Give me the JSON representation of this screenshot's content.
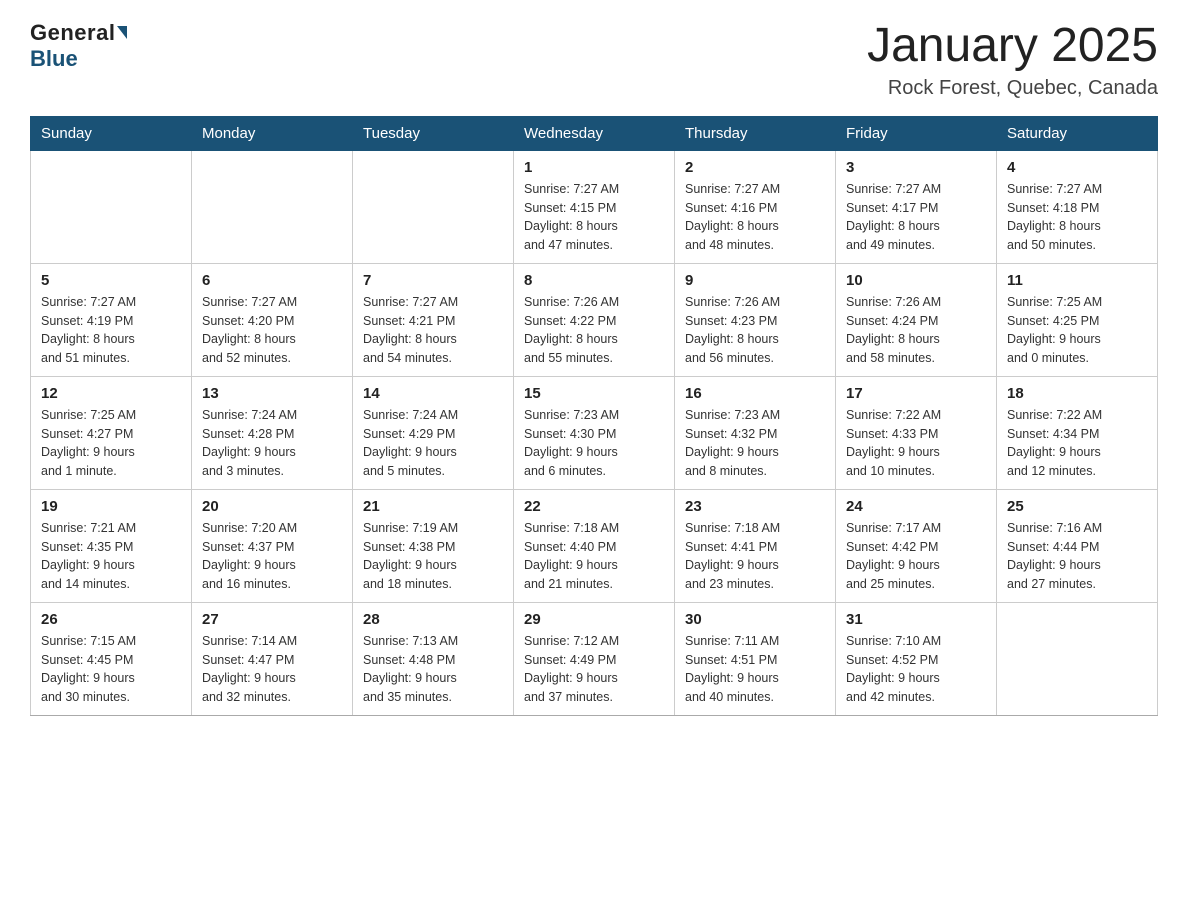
{
  "logo": {
    "general": "General",
    "blue": "Blue"
  },
  "title": "January 2025",
  "subtitle": "Rock Forest, Quebec, Canada",
  "days_of_week": [
    "Sunday",
    "Monday",
    "Tuesday",
    "Wednesday",
    "Thursday",
    "Friday",
    "Saturday"
  ],
  "weeks": [
    [
      {
        "day": "",
        "info": ""
      },
      {
        "day": "",
        "info": ""
      },
      {
        "day": "",
        "info": ""
      },
      {
        "day": "1",
        "info": "Sunrise: 7:27 AM\nSunset: 4:15 PM\nDaylight: 8 hours\nand 47 minutes."
      },
      {
        "day": "2",
        "info": "Sunrise: 7:27 AM\nSunset: 4:16 PM\nDaylight: 8 hours\nand 48 minutes."
      },
      {
        "day": "3",
        "info": "Sunrise: 7:27 AM\nSunset: 4:17 PM\nDaylight: 8 hours\nand 49 minutes."
      },
      {
        "day": "4",
        "info": "Sunrise: 7:27 AM\nSunset: 4:18 PM\nDaylight: 8 hours\nand 50 minutes."
      }
    ],
    [
      {
        "day": "5",
        "info": "Sunrise: 7:27 AM\nSunset: 4:19 PM\nDaylight: 8 hours\nand 51 minutes."
      },
      {
        "day": "6",
        "info": "Sunrise: 7:27 AM\nSunset: 4:20 PM\nDaylight: 8 hours\nand 52 minutes."
      },
      {
        "day": "7",
        "info": "Sunrise: 7:27 AM\nSunset: 4:21 PM\nDaylight: 8 hours\nand 54 minutes."
      },
      {
        "day": "8",
        "info": "Sunrise: 7:26 AM\nSunset: 4:22 PM\nDaylight: 8 hours\nand 55 minutes."
      },
      {
        "day": "9",
        "info": "Sunrise: 7:26 AM\nSunset: 4:23 PM\nDaylight: 8 hours\nand 56 minutes."
      },
      {
        "day": "10",
        "info": "Sunrise: 7:26 AM\nSunset: 4:24 PM\nDaylight: 8 hours\nand 58 minutes."
      },
      {
        "day": "11",
        "info": "Sunrise: 7:25 AM\nSunset: 4:25 PM\nDaylight: 9 hours\nand 0 minutes."
      }
    ],
    [
      {
        "day": "12",
        "info": "Sunrise: 7:25 AM\nSunset: 4:27 PM\nDaylight: 9 hours\nand 1 minute."
      },
      {
        "day": "13",
        "info": "Sunrise: 7:24 AM\nSunset: 4:28 PM\nDaylight: 9 hours\nand 3 minutes."
      },
      {
        "day": "14",
        "info": "Sunrise: 7:24 AM\nSunset: 4:29 PM\nDaylight: 9 hours\nand 5 minutes."
      },
      {
        "day": "15",
        "info": "Sunrise: 7:23 AM\nSunset: 4:30 PM\nDaylight: 9 hours\nand 6 minutes."
      },
      {
        "day": "16",
        "info": "Sunrise: 7:23 AM\nSunset: 4:32 PM\nDaylight: 9 hours\nand 8 minutes."
      },
      {
        "day": "17",
        "info": "Sunrise: 7:22 AM\nSunset: 4:33 PM\nDaylight: 9 hours\nand 10 minutes."
      },
      {
        "day": "18",
        "info": "Sunrise: 7:22 AM\nSunset: 4:34 PM\nDaylight: 9 hours\nand 12 minutes."
      }
    ],
    [
      {
        "day": "19",
        "info": "Sunrise: 7:21 AM\nSunset: 4:35 PM\nDaylight: 9 hours\nand 14 minutes."
      },
      {
        "day": "20",
        "info": "Sunrise: 7:20 AM\nSunset: 4:37 PM\nDaylight: 9 hours\nand 16 minutes."
      },
      {
        "day": "21",
        "info": "Sunrise: 7:19 AM\nSunset: 4:38 PM\nDaylight: 9 hours\nand 18 minutes."
      },
      {
        "day": "22",
        "info": "Sunrise: 7:18 AM\nSunset: 4:40 PM\nDaylight: 9 hours\nand 21 minutes."
      },
      {
        "day": "23",
        "info": "Sunrise: 7:18 AM\nSunset: 4:41 PM\nDaylight: 9 hours\nand 23 minutes."
      },
      {
        "day": "24",
        "info": "Sunrise: 7:17 AM\nSunset: 4:42 PM\nDaylight: 9 hours\nand 25 minutes."
      },
      {
        "day": "25",
        "info": "Sunrise: 7:16 AM\nSunset: 4:44 PM\nDaylight: 9 hours\nand 27 minutes."
      }
    ],
    [
      {
        "day": "26",
        "info": "Sunrise: 7:15 AM\nSunset: 4:45 PM\nDaylight: 9 hours\nand 30 minutes."
      },
      {
        "day": "27",
        "info": "Sunrise: 7:14 AM\nSunset: 4:47 PM\nDaylight: 9 hours\nand 32 minutes."
      },
      {
        "day": "28",
        "info": "Sunrise: 7:13 AM\nSunset: 4:48 PM\nDaylight: 9 hours\nand 35 minutes."
      },
      {
        "day": "29",
        "info": "Sunrise: 7:12 AM\nSunset: 4:49 PM\nDaylight: 9 hours\nand 37 minutes."
      },
      {
        "day": "30",
        "info": "Sunrise: 7:11 AM\nSunset: 4:51 PM\nDaylight: 9 hours\nand 40 minutes."
      },
      {
        "day": "31",
        "info": "Sunrise: 7:10 AM\nSunset: 4:52 PM\nDaylight: 9 hours\nand 42 minutes."
      },
      {
        "day": "",
        "info": ""
      }
    ]
  ]
}
